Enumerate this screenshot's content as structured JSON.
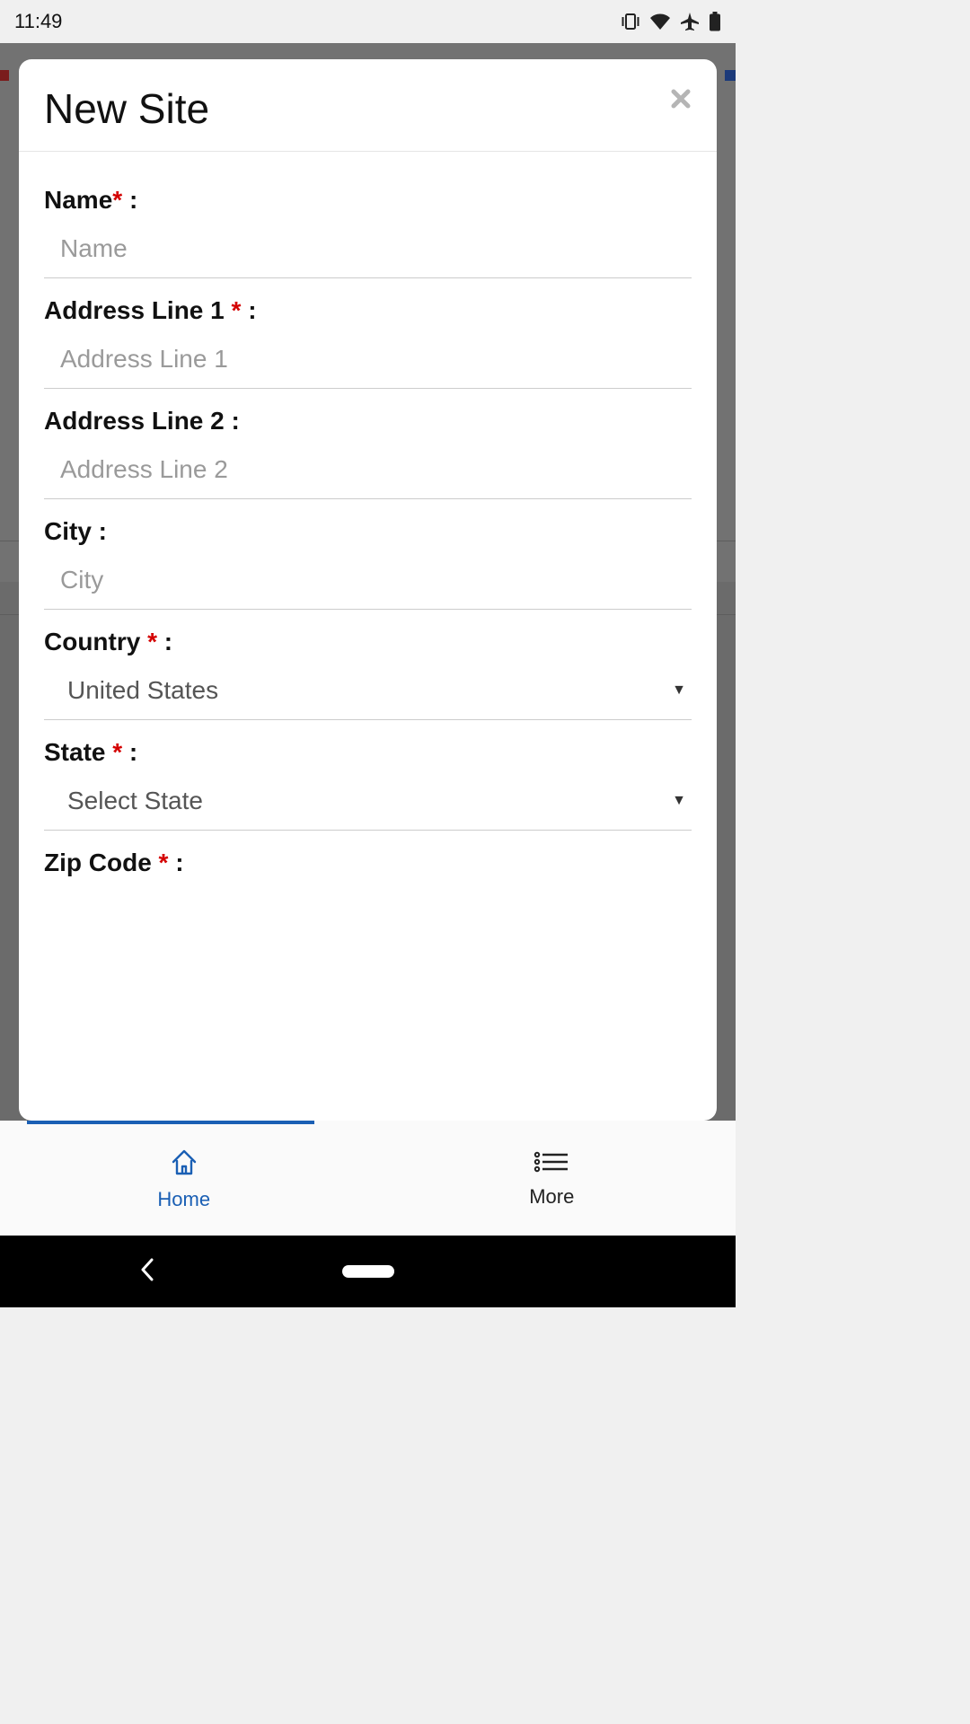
{
  "status": {
    "time": "11:49"
  },
  "modal": {
    "title": "New Site",
    "fields": {
      "name": {
        "label": "Name",
        "required": true,
        "placeholder": "Name"
      },
      "addr1": {
        "label": "Address Line 1",
        "required": true,
        "placeholder": "Address Line 1"
      },
      "addr2": {
        "label": "Address Line 2",
        "required": false,
        "placeholder": "Address Line 2"
      },
      "city": {
        "label": "City",
        "required": false,
        "placeholder": "City"
      },
      "country": {
        "label": "Country",
        "required": true,
        "value": "United States"
      },
      "state": {
        "label": "State",
        "required": true,
        "value": "Select State"
      },
      "zip": {
        "label": "Zip Code",
        "required": true
      }
    }
  },
  "tabs": {
    "home": "Home",
    "more": "More"
  }
}
